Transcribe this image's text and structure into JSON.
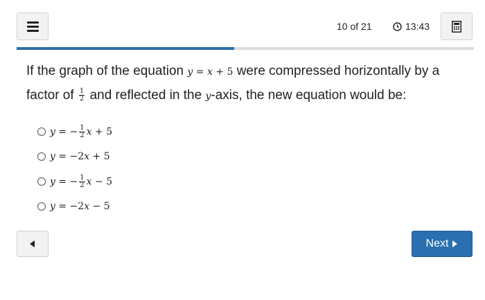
{
  "header": {
    "menu_icon": "hamburger-menu-icon",
    "progress_text": "10 of 21",
    "timer_icon": "clock-icon",
    "timer_text": "13:43",
    "calculator_icon": "calculator-icon"
  },
  "progress": {
    "current": 10,
    "total": 21,
    "fraction": 0.476,
    "fill_color": "#2e6da4",
    "track_color": "#dddddd"
  },
  "question": {
    "part1": "If the graph of the equation ",
    "eq_y": "y",
    "eq_eq": " = ",
    "eq_x": "x",
    "eq_rest": " + 5",
    "part2": " were compressed horizontally by a factor of ",
    "frac_num": "1",
    "frac_den": "2",
    "part3": " and reflected in the ",
    "axis_var": "y",
    "part4": "-axis, the new equation would be:"
  },
  "options": [
    {
      "y": "y",
      "eq": " = −",
      "frac_num": "1",
      "frac_den": "2",
      "x": "x",
      "rest": " + 5"
    },
    {
      "y": "y",
      "eq": " = −2",
      "x": "x",
      "rest": " + 5"
    },
    {
      "y": "y",
      "eq": " = −",
      "frac_num": "1",
      "frac_den": "2",
      "x": "x",
      "rest": " − 5"
    },
    {
      "y": "y",
      "eq": " = −2",
      "x": "x",
      "rest": " − 5"
    }
  ],
  "footer": {
    "back_icon": "triangle-left-icon",
    "next_label": "Next",
    "next_icon": "triangle-right-icon",
    "next_color": "#2a6faf"
  }
}
